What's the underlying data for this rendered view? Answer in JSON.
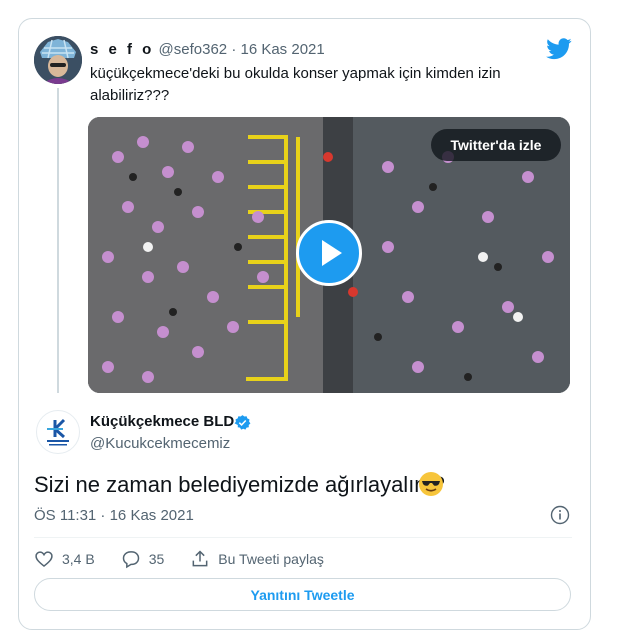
{
  "brand_color": "#1d9bf0",
  "parent_tweet": {
    "display_name": "s e f o",
    "handle": "@sefo362",
    "separator": "·",
    "date": "16 Kas 2021",
    "text": "küçükçekmece'deki bu okulda konser yapmak için kimden izin alabiliriz???",
    "avatar_icon": "avatar-photo",
    "media": {
      "type": "video",
      "watch_label": "Twitter'da izle",
      "play_icon": "play-icon"
    }
  },
  "reply_tweet": {
    "display_name": "Küçükçekmece BLD",
    "verified_icon": "verified-badge-icon",
    "handle": "@Kucukcekmecemiz",
    "text": "Sizi ne zaman belediyemizde ağırlayalım?",
    "emoji": "sunglasses-emoji",
    "timestamp": "ÖS 11:31 · 16 Kas 2021",
    "actions": {
      "likes": "3,4 B",
      "replies": "35",
      "share_label": "Bu Tweeti paylaş"
    },
    "reply_button_label": "Yanıtını Tweetle"
  }
}
